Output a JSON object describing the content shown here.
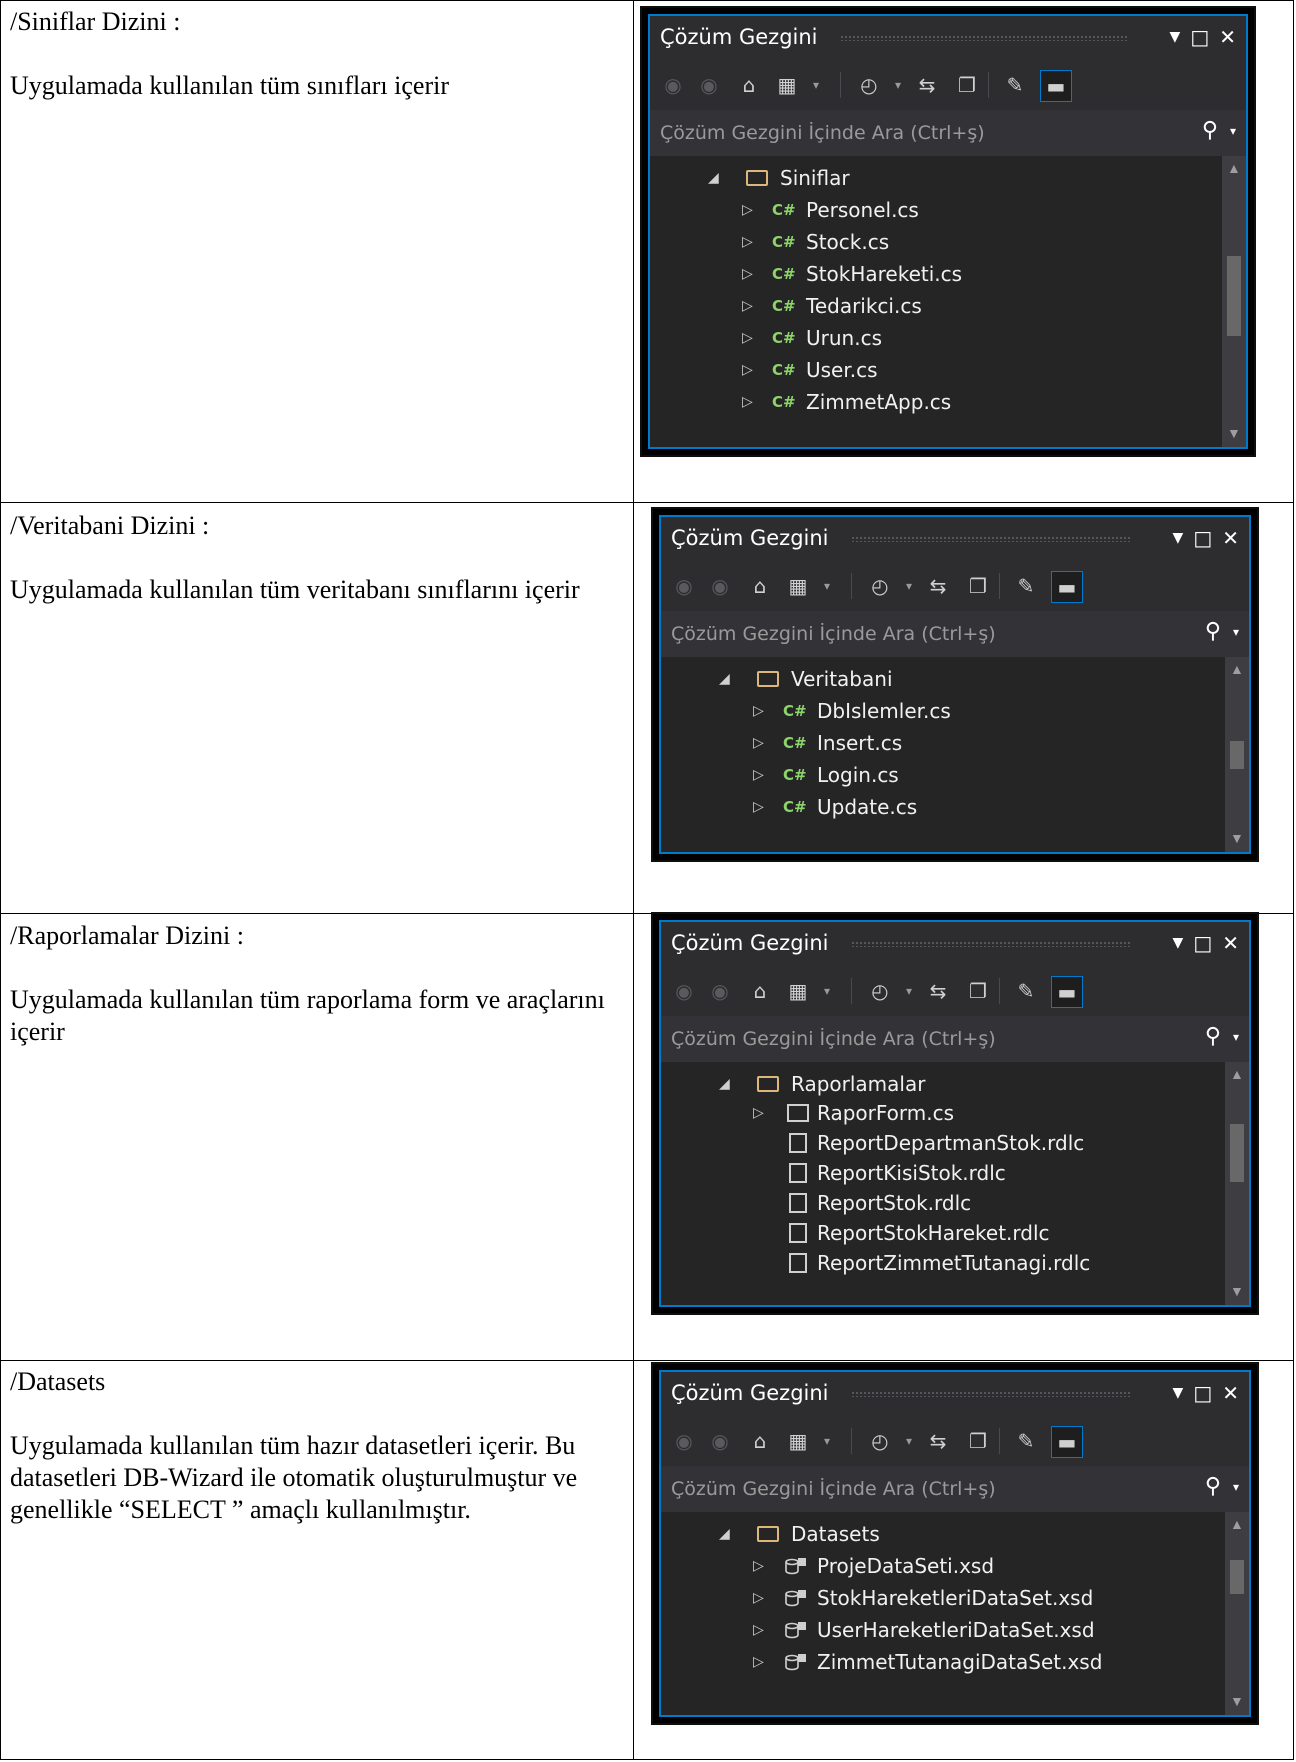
{
  "sections": [
    {
      "title": "/Siniflar Dizini :",
      "desc": "Uygulamada kullanılan tüm sınıfları içerir",
      "folder": "Siniflar",
      "items": [
        {
          "label": "Personel.cs",
          "icon": "csharp-file-icon"
        },
        {
          "label": "Stock.cs",
          "icon": "csharp-file-icon"
        },
        {
          "label": "StokHareketi.cs",
          "icon": "csharp-file-icon"
        },
        {
          "label": "Tedarikci.cs",
          "icon": "csharp-file-icon"
        },
        {
          "label": "Urun.cs",
          "icon": "csharp-file-icon"
        },
        {
          "label": "User.cs",
          "icon": "csharp-file-icon"
        },
        {
          "label": "ZimmetApp.cs",
          "icon": "csharp-file-icon"
        }
      ]
    },
    {
      "title": "/Veritabani Dizini :",
      "desc": "Uygulamada kullanılan tüm veritabanı sınıflarını  içerir",
      "folder": "Veritabani",
      "items": [
        {
          "label": "DbIslemler.cs",
          "icon": "csharp-file-icon"
        },
        {
          "label": "Insert.cs",
          "icon": "csharp-file-icon"
        },
        {
          "label": "Login.cs",
          "icon": "csharp-file-icon"
        },
        {
          "label": "Update.cs",
          "icon": "csharp-file-icon"
        }
      ]
    },
    {
      "title": "/Raporlamalar Dizini :",
      "desc": "Uygulamada kullanılan tüm raporlama form ve araçlarını içerir",
      "folder": "Raporlamalar",
      "items": [
        {
          "label": "RaporForm.cs",
          "icon": "form-icon"
        },
        {
          "label": "ReportDepartmanStok.rdlc",
          "icon": "report-icon"
        },
        {
          "label": "ReportKisiStok.rdlc",
          "icon": "report-icon"
        },
        {
          "label": "ReportStok.rdlc",
          "icon": "report-icon"
        },
        {
          "label": "ReportStokHareket.rdlc",
          "icon": "report-icon"
        },
        {
          "label": "ReportZimmetTutanagi.rdlc",
          "icon": "report-icon"
        }
      ]
    },
    {
      "title": "/Datasets",
      "desc": "Uygulamada kullanılan tüm hazır datasetleri içerir. Bu datasetleri DB-Wizard ile otomatik oluşturulmuştur ve genellikle “SELECT ” amaçlı kullanılmıştır.",
      "folder": "Datasets",
      "items": [
        {
          "label": "ProjeDataSeti.xsd",
          "icon": "dataset-icon"
        },
        {
          "label": "StokHareketleriDataSet.xsd",
          "icon": "dataset-icon"
        },
        {
          "label": "UserHareketleriDataSet.xsd",
          "icon": "dataset-icon"
        },
        {
          "label": "ZimmetTutanagiDataSet.xsd",
          "icon": "dataset-icon"
        }
      ]
    }
  ],
  "explorer": {
    "title": "Çözüm Gezgini",
    "search_placeholder": "Çözüm Gezgini İçinde Ara (Ctrl+ş)"
  },
  "colors": {
    "accent": "#007acc",
    "panel_bg": "#252526",
    "csharp": "#8ed36b",
    "folder": "#dcb67a"
  }
}
